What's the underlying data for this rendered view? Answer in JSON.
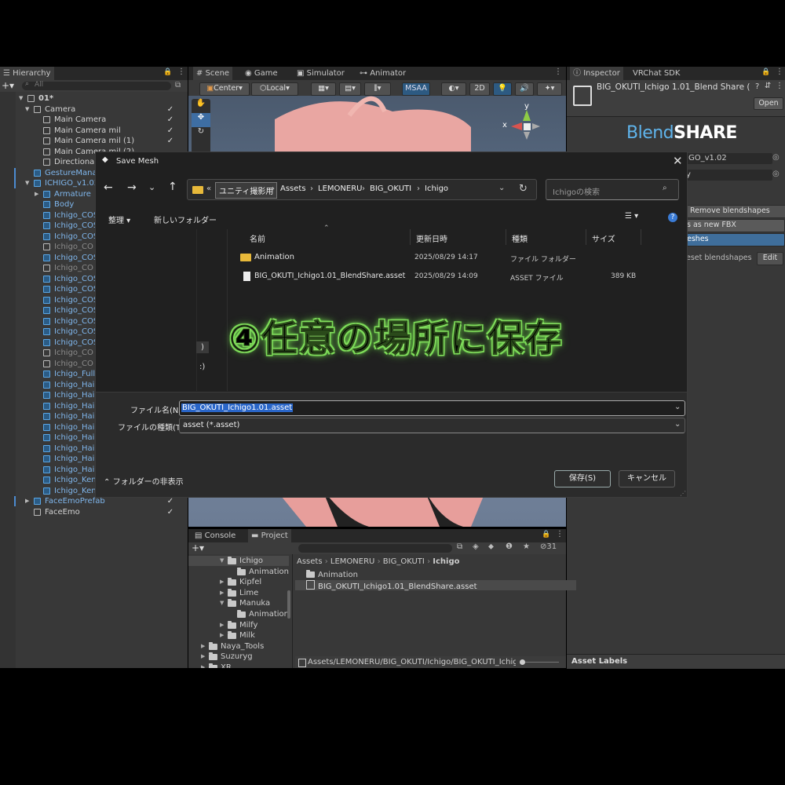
{
  "hierarchy": {
    "tab_label": "Hierarchy",
    "search_placeholder": "All",
    "rows": [
      {
        "label": "01*",
        "style": "normal"
      },
      {
        "label": "Camera",
        "style": "normal"
      },
      {
        "label": "Main Camera",
        "style": "normal"
      },
      {
        "label": "Main Camera mil",
        "style": "normal"
      },
      {
        "label": "Main Camera mil (1)",
        "style": "normal"
      },
      {
        "label": "Main Camera mil (2)",
        "style": "normal"
      },
      {
        "label": "Directional",
        "style": "normal"
      },
      {
        "label": "GestureMana",
        "style": "blue"
      },
      {
        "label": "ICHIGO_v1.02",
        "style": "blue"
      },
      {
        "label": "Armature",
        "style": "blue"
      },
      {
        "label": "Body",
        "style": "blue"
      },
      {
        "label": "Ichigo_COS",
        "style": "blue"
      },
      {
        "label": "Ichigo_COS",
        "style": "blue"
      },
      {
        "label": "Ichigo_COS",
        "style": "blue"
      },
      {
        "label": "Ichigo_CO",
        "style": "gray"
      },
      {
        "label": "Ichigo_COS",
        "style": "blue"
      },
      {
        "label": "Ichigo_CO",
        "style": "gray"
      },
      {
        "label": "Ichigo_COS",
        "style": "blue"
      },
      {
        "label": "Ichigo_COS",
        "style": "blue"
      },
      {
        "label": "Ichigo_COS",
        "style": "blue"
      },
      {
        "label": "Ichigo_COS",
        "style": "blue"
      },
      {
        "label": "Ichigo_COS",
        "style": "blue"
      },
      {
        "label": "Ichigo_COS",
        "style": "blue"
      },
      {
        "label": "Ichigo_COS",
        "style": "blue"
      },
      {
        "label": "Ichigo_CO",
        "style": "gray"
      },
      {
        "label": "Ichigo_CO",
        "style": "gray"
      },
      {
        "label": "Ichigo_Full",
        "style": "blue"
      },
      {
        "label": "Ichigo_Hai",
        "style": "blue"
      },
      {
        "label": "Ichigo_Hai",
        "style": "blue"
      },
      {
        "label": "Ichigo_Hai",
        "style": "blue"
      },
      {
        "label": "Ichigo_Hai",
        "style": "blue"
      },
      {
        "label": "Ichigo_Hai",
        "style": "blue"
      },
      {
        "label": "Ichigo_Hai",
        "style": "blue"
      },
      {
        "label": "Ichigo_Hai",
        "style": "blue"
      },
      {
        "label": "Ichigo_Hai",
        "style": "blue"
      },
      {
        "label": "Ichigo_Hai",
        "style": "blue"
      },
      {
        "label": "Ichigo_Ken",
        "style": "blue"
      },
      {
        "label": "Ichigo_Ken",
        "style": "blue"
      },
      {
        "label": "FaceEmoPrefab",
        "style": "blue"
      },
      {
        "label": "FaceEmo",
        "style": "normal"
      }
    ]
  },
  "scene": {
    "tabs": [
      "Scene",
      "Game",
      "Simulator",
      "Animator"
    ],
    "toolbar": {
      "pivot": "Center",
      "space": "Local",
      "msaa": "MSAA",
      "mode2d": "2D"
    },
    "gizmo": {
      "y": "y",
      "x": "x"
    }
  },
  "inspector": {
    "tabs": [
      "Inspector",
      "VRChat SDK"
    ],
    "object_name": "BIG_OKUTI_Ichigo 1.01_Blend Share (",
    "open_label": "Open",
    "logo_blend": "Blend",
    "logo_share": "SHARE",
    "field_value": "IGO_v1.02",
    "field_value2": "y",
    "remove_label": "Remove blendshapes",
    "save_fbx_label": "s as new FBX",
    "meshes_label": "eshes",
    "reset_label": "eset blendshapes",
    "edit_label": "Edit",
    "asset_labels": "Asset Labels"
  },
  "dialog": {
    "title": "Save Mesh",
    "breadcrumb_short": "«",
    "breadcrumb": [
      "ユニティ撮影用",
      "Assets",
      "LEMONERU",
      "BIG_OKUTI",
      "Ichigo"
    ],
    "search_placeholder": "Ichigoの検索",
    "organize": "整理",
    "new_folder": "新しいフォルダー",
    "columns": {
      "name": "名前",
      "modified": "更新日時",
      "type": "種類",
      "size": "サイズ"
    },
    "files": [
      {
        "name": "Animation",
        "modified": "2025/08/29 14:17",
        "type": "ファイル フォルダー",
        "size": "",
        "kind": "folder"
      },
      {
        "name": "BIG_OKUTI_Ichigo1.01_BlendShare.asset",
        "modified": "2025/08/29 14:09",
        "type": "ASSET ファイル",
        "size": "389 KB",
        "kind": "file"
      }
    ],
    "filename_label": "ファイル名(N):",
    "filename_value": "BIG_OKUTI_Ichigo1.01.asset",
    "filetype_label": "ファイルの種類(T):",
    "filetype_value": "asset (*.asset)",
    "hide_folders": "フォルダーの非表示",
    "save_button": "保存(S)",
    "cancel_button": "キャンセル",
    "left_fragment1": ")",
    "left_fragment2": ":)"
  },
  "caption": "④任意の場所に保存",
  "project": {
    "tabs": [
      "Console",
      "Project"
    ],
    "count": "31",
    "tree": [
      {
        "label": "Ichigo",
        "indent": 3,
        "open": true
      },
      {
        "label": "Animation",
        "indent": 4,
        "open": false
      },
      {
        "label": "Kipfel",
        "indent": 3,
        "open": false
      },
      {
        "label": "Lime",
        "indent": 3,
        "open": false
      },
      {
        "label": "Manuka",
        "indent": 3,
        "open": true
      },
      {
        "label": "Animation",
        "indent": 4,
        "open": false
      },
      {
        "label": "Milfy",
        "indent": 3,
        "open": false
      },
      {
        "label": "Milk",
        "indent": 3,
        "open": false
      },
      {
        "label": "Naya_Tools",
        "indent": 1,
        "open": false
      },
      {
        "label": "Suzuryg",
        "indent": 1,
        "open": false
      },
      {
        "label": "XR",
        "indent": 1,
        "open": false
      }
    ],
    "breadcrumb": [
      "Assets",
      "LEMONERU",
      "BIG_OKUTI",
      "Ichigo"
    ],
    "items": [
      "Animation",
      "BIG_OKUTI_Ichigo1.01_BlendShare.asset"
    ],
    "path": "Assets/LEMONERU/BIG_OKUTI/Ichigo/BIG_OKUTI_Ichigo"
  }
}
